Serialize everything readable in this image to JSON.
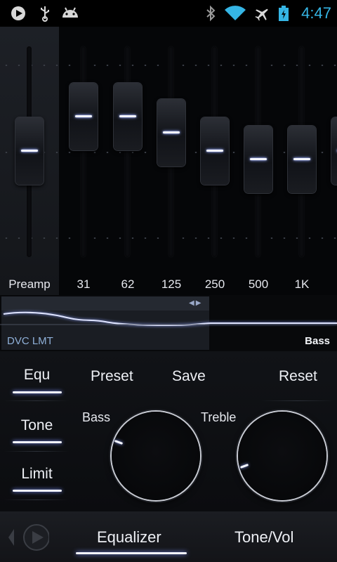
{
  "status_bar": {
    "left_icons": [
      "play-icon",
      "usb-icon",
      "android-icon"
    ],
    "right_icons": [
      "bluetooth-icon",
      "wifi-icon",
      "airplane-icon",
      "battery-icon"
    ],
    "time": "4:47",
    "accent_color": "#35b5e5"
  },
  "equalizer": {
    "preamp": {
      "label": "Preamp"
    },
    "bands": [
      {
        "label": "31"
      },
      {
        "label": "62"
      },
      {
        "label": "125"
      },
      {
        "label": "250"
      },
      {
        "label": "500"
      },
      {
        "label": "1K"
      }
    ]
  },
  "curve_panel": {
    "left_label": "DVC LMT",
    "right_label": "Bass",
    "scroll_arrows": "◀▶"
  },
  "side_tabs": [
    {
      "label": "Equ"
    },
    {
      "label": "Tone"
    },
    {
      "label": "Limit"
    }
  ],
  "top_actions": {
    "preset": "Preset",
    "save": "Save",
    "reset": "Reset"
  },
  "knobs": {
    "bass": {
      "label": "Bass"
    },
    "treble": {
      "label": "Treble"
    }
  },
  "bottom_tabs": {
    "equalizer": "Equalizer",
    "tone_vol": "Tone/Vol"
  }
}
